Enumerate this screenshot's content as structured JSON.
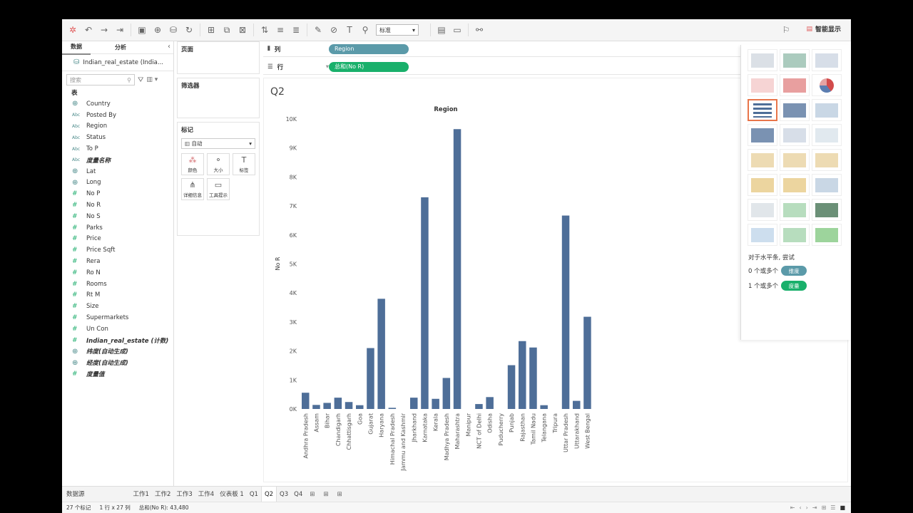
{
  "toolbar": {
    "format_select": "标准",
    "smart_show": "智能显示"
  },
  "data_pane": {
    "tab_data": "数据",
    "tab_analysis": "分析",
    "datasource": "Indian_real_estate (India...",
    "search_placeholder": "搜索",
    "table_header": "表",
    "fields": [
      {
        "type": "globe",
        "name": "Country",
        "italic": false
      },
      {
        "type": "abc",
        "name": "Posted By",
        "italic": false
      },
      {
        "type": "abc",
        "name": "Region",
        "italic": false
      },
      {
        "type": "abc",
        "name": "Status",
        "italic": false
      },
      {
        "type": "abc",
        "name": "To P",
        "italic": false
      },
      {
        "type": "abc",
        "name": "度量名称",
        "italic": true
      },
      {
        "type": "globe",
        "name": "Lat",
        "italic": false
      },
      {
        "type": "globe",
        "name": "Long",
        "italic": false
      },
      {
        "type": "hash",
        "name": "No P",
        "italic": false
      },
      {
        "type": "hash",
        "name": "No R",
        "italic": false
      },
      {
        "type": "hash",
        "name": "No S",
        "italic": false
      },
      {
        "type": "hash",
        "name": "Parks",
        "italic": false
      },
      {
        "type": "hash",
        "name": "Price",
        "italic": false
      },
      {
        "type": "hash",
        "name": "Price Sqft",
        "italic": false
      },
      {
        "type": "hash",
        "name": "Rera",
        "italic": false
      },
      {
        "type": "hash",
        "name": "Ro N",
        "italic": false
      },
      {
        "type": "hash",
        "name": "Rooms",
        "italic": false
      },
      {
        "type": "hash",
        "name": "Rt M",
        "italic": false
      },
      {
        "type": "hash",
        "name": "Size",
        "italic": false
      },
      {
        "type": "hash",
        "name": "Supermarkets",
        "italic": false
      },
      {
        "type": "hash",
        "name": "Un Con",
        "italic": false
      },
      {
        "type": "hash",
        "name": "Indian_real_estate (计数)",
        "italic": true
      },
      {
        "type": "globe",
        "name": "纬度(自动生成)",
        "italic": true
      },
      {
        "type": "globe",
        "name": "经度(自动生成)",
        "italic": true
      },
      {
        "type": "hash",
        "name": "度量值",
        "italic": true
      }
    ]
  },
  "cards": {
    "pages": "页面",
    "filters": "筛选器",
    "marks": "标记",
    "marks_type": "自动",
    "mark_color": "颜色",
    "mark_size": "大小",
    "mark_label": "标签",
    "mark_detail": "详细信息",
    "mark_tooltip": "工具提示"
  },
  "shelves": {
    "columns_label": "列",
    "rows_label": "行",
    "columns_pill": "Region",
    "rows_pill": "总和(No R)"
  },
  "sheet_title": "Q2",
  "show_me": {
    "hint": "对于水平条, 尝试",
    "line1_prefix": "0 个或多个",
    "line1_pill": "维度",
    "line2_prefix": "1 个或多个",
    "line2_pill": "度量"
  },
  "tabs": [
    "数据源",
    "工作1",
    "工作2",
    "工作3",
    "工作4",
    "仪表板 1",
    "Q1",
    "Q2",
    "Q3",
    "Q4"
  ],
  "status": {
    "marks": "27 个标记",
    "rows_cols": "1 行 x 27 列",
    "sum": "总和(No R): 43,480"
  },
  "colors": {
    "bar": "#4e6e98",
    "dim_pill": "#5b9aa9",
    "meas_pill": "#19b06b"
  },
  "chart_data": {
    "type": "bar",
    "title": "Region",
    "xlabel": "",
    "ylabel": "No R",
    "ylim": [
      0,
      10000
    ],
    "yticks": [
      "0K",
      "1K",
      "2K",
      "3K",
      "4K",
      "5K",
      "6K",
      "7K",
      "8K",
      "9K",
      "10K"
    ],
    "categories": [
      "Andhra Pradesh",
      "Assam",
      "Bihar",
      "Chandigarh",
      "Chhattisgarh",
      "Goa",
      "Gujarat",
      "Haryana",
      "Himachal Pradesh",
      "Jammu and Kashmir",
      "Jharkhand",
      "Karnataka",
      "Kerala",
      "Madhya Pradesh",
      "Maharashtra",
      "Manipur",
      "NCT of Delhi",
      "Odisha",
      "Puducherry",
      "Punjab",
      "Rajasthan",
      "Tamil Nadu",
      "Telangana",
      "Tripura",
      "Uttar Pradesh",
      "Uttarakhand",
      "West Bengal"
    ],
    "values": [
      560,
      140,
      210,
      390,
      240,
      130,
      2100,
      3800,
      40,
      0,
      390,
      7300,
      350,
      1070,
      9650,
      0,
      170,
      410,
      0,
      1510,
      2340,
      2120,
      130,
      0,
      6670,
      280,
      3180
    ]
  }
}
